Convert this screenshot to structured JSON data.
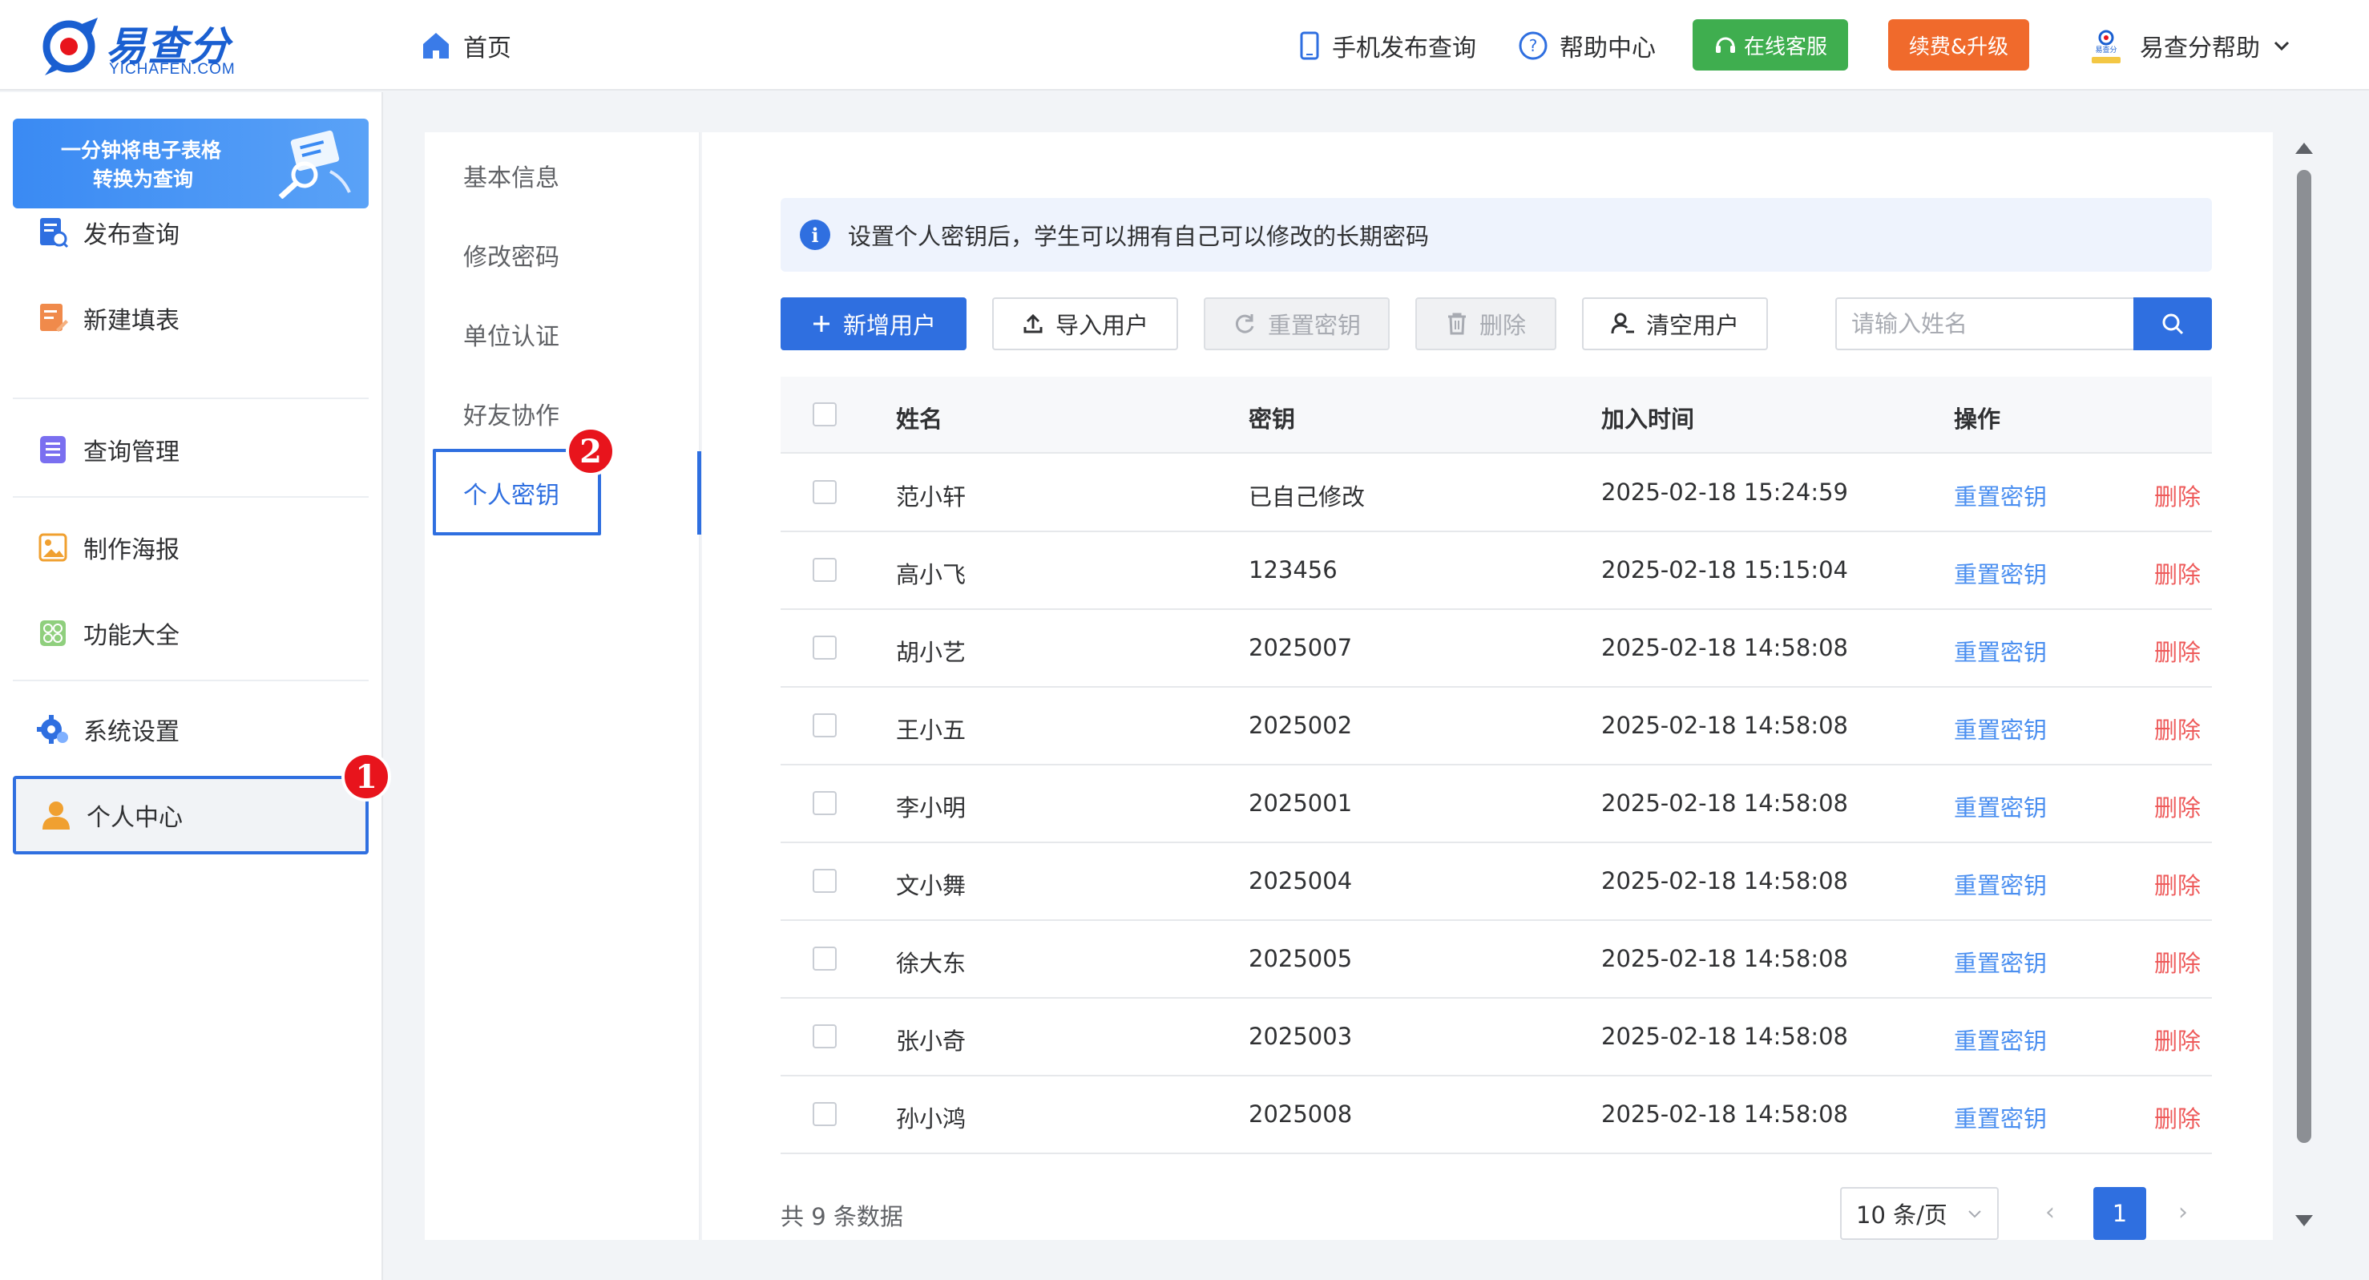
{
  "header": {
    "logo_text": "易查分",
    "logo_sub": "YICHAFEN.COM",
    "home_label": "首页",
    "mobile_publish_label": "手机发布查询",
    "help_center_label": "帮助中心",
    "online_service_label": "在线客服",
    "upgrade_label": "续费&升级",
    "user_name": "易查分帮助",
    "avatar_caption": "易查分"
  },
  "sidebar": {
    "promo_line1": "一分钟将电子表格",
    "promo_line2": "转换为查询",
    "items": [
      {
        "label": "发布查询"
      },
      {
        "label": "新建填表"
      },
      {
        "label": "查询管理"
      },
      {
        "label": "制作海报"
      },
      {
        "label": "功能大全"
      },
      {
        "label": "系统设置"
      },
      {
        "label": "个人中心"
      }
    ],
    "active_index": 6
  },
  "markers": [
    "1",
    "2"
  ],
  "subnav": {
    "items": [
      {
        "label": "基本信息"
      },
      {
        "label": "修改密码"
      },
      {
        "label": "单位认证"
      },
      {
        "label": "好友协作"
      },
      {
        "label": "个人密钥"
      }
    ],
    "active_index": 4
  },
  "notice": {
    "icon_text": "i",
    "text": "设置个人密钥后，学生可以拥有自己可以修改的长期密码"
  },
  "toolbar": {
    "add_user": "新增用户",
    "import_user": "导入用户",
    "reset_key": "重置密钥",
    "delete": "删除",
    "clear_users": "清空用户",
    "search_placeholder": "请输入姓名"
  },
  "table": {
    "columns": [
      "姓名",
      "密钥",
      "加入时间",
      "操作"
    ],
    "rows": [
      {
        "name": "范小轩",
        "key": "已自己修改",
        "joined": "2025-02-18 15:24:59",
        "action_reset": "重置密钥",
        "action_delete": "删除"
      },
      {
        "name": "高小飞",
        "key": "123456",
        "joined": "2025-02-18 15:15:04",
        "action_reset": "重置密钥",
        "action_delete": "删除"
      },
      {
        "name": "胡小艺",
        "key": "2025007",
        "joined": "2025-02-18 14:58:08",
        "action_reset": "重置密钥",
        "action_delete": "删除"
      },
      {
        "name": "王小五",
        "key": "2025002",
        "joined": "2025-02-18 14:58:08",
        "action_reset": "重置密钥",
        "action_delete": "删除"
      },
      {
        "name": "李小明",
        "key": "2025001",
        "joined": "2025-02-18 14:58:08",
        "action_reset": "重置密钥",
        "action_delete": "删除"
      },
      {
        "name": "文小舞",
        "key": "2025004",
        "joined": "2025-02-18 14:58:08",
        "action_reset": "重置密钥",
        "action_delete": "删除"
      },
      {
        "name": "徐大东",
        "key": "2025005",
        "joined": "2025-02-18 14:58:08",
        "action_reset": "重置密钥",
        "action_delete": "删除"
      },
      {
        "name": "张小奇",
        "key": "2025003",
        "joined": "2025-02-18 14:58:08",
        "action_reset": "重置密钥",
        "action_delete": "删除"
      },
      {
        "name": "孙小鸿",
        "key": "2025008",
        "joined": "2025-02-18 14:58:08",
        "action_reset": "重置密钥",
        "action_delete": "删除"
      }
    ]
  },
  "pagination": {
    "total_text": "共 9 条数据",
    "page_size": "10 条/页",
    "prev": "‹",
    "next": "›",
    "current_page": "1"
  },
  "colors": {
    "primary": "#2f6fe0",
    "service_green": "#3fae4f",
    "upgrade_orange": "#f06a2c",
    "marker_red": "#e8141c",
    "link_blue": "#4b8ff0",
    "link_red": "#ee5a5a"
  },
  "icons": {
    "home": "home-icon",
    "mobile": "mobile-icon",
    "help": "question-circle-icon",
    "headset": "headset-icon",
    "chevron": "chevron-down-icon",
    "search": "search-icon",
    "plus": "plus-icon",
    "upload": "upload-icon",
    "refresh": "refresh-icon",
    "trash": "trash-icon",
    "user_clear": "user-clear-icon",
    "info": "info-icon"
  }
}
